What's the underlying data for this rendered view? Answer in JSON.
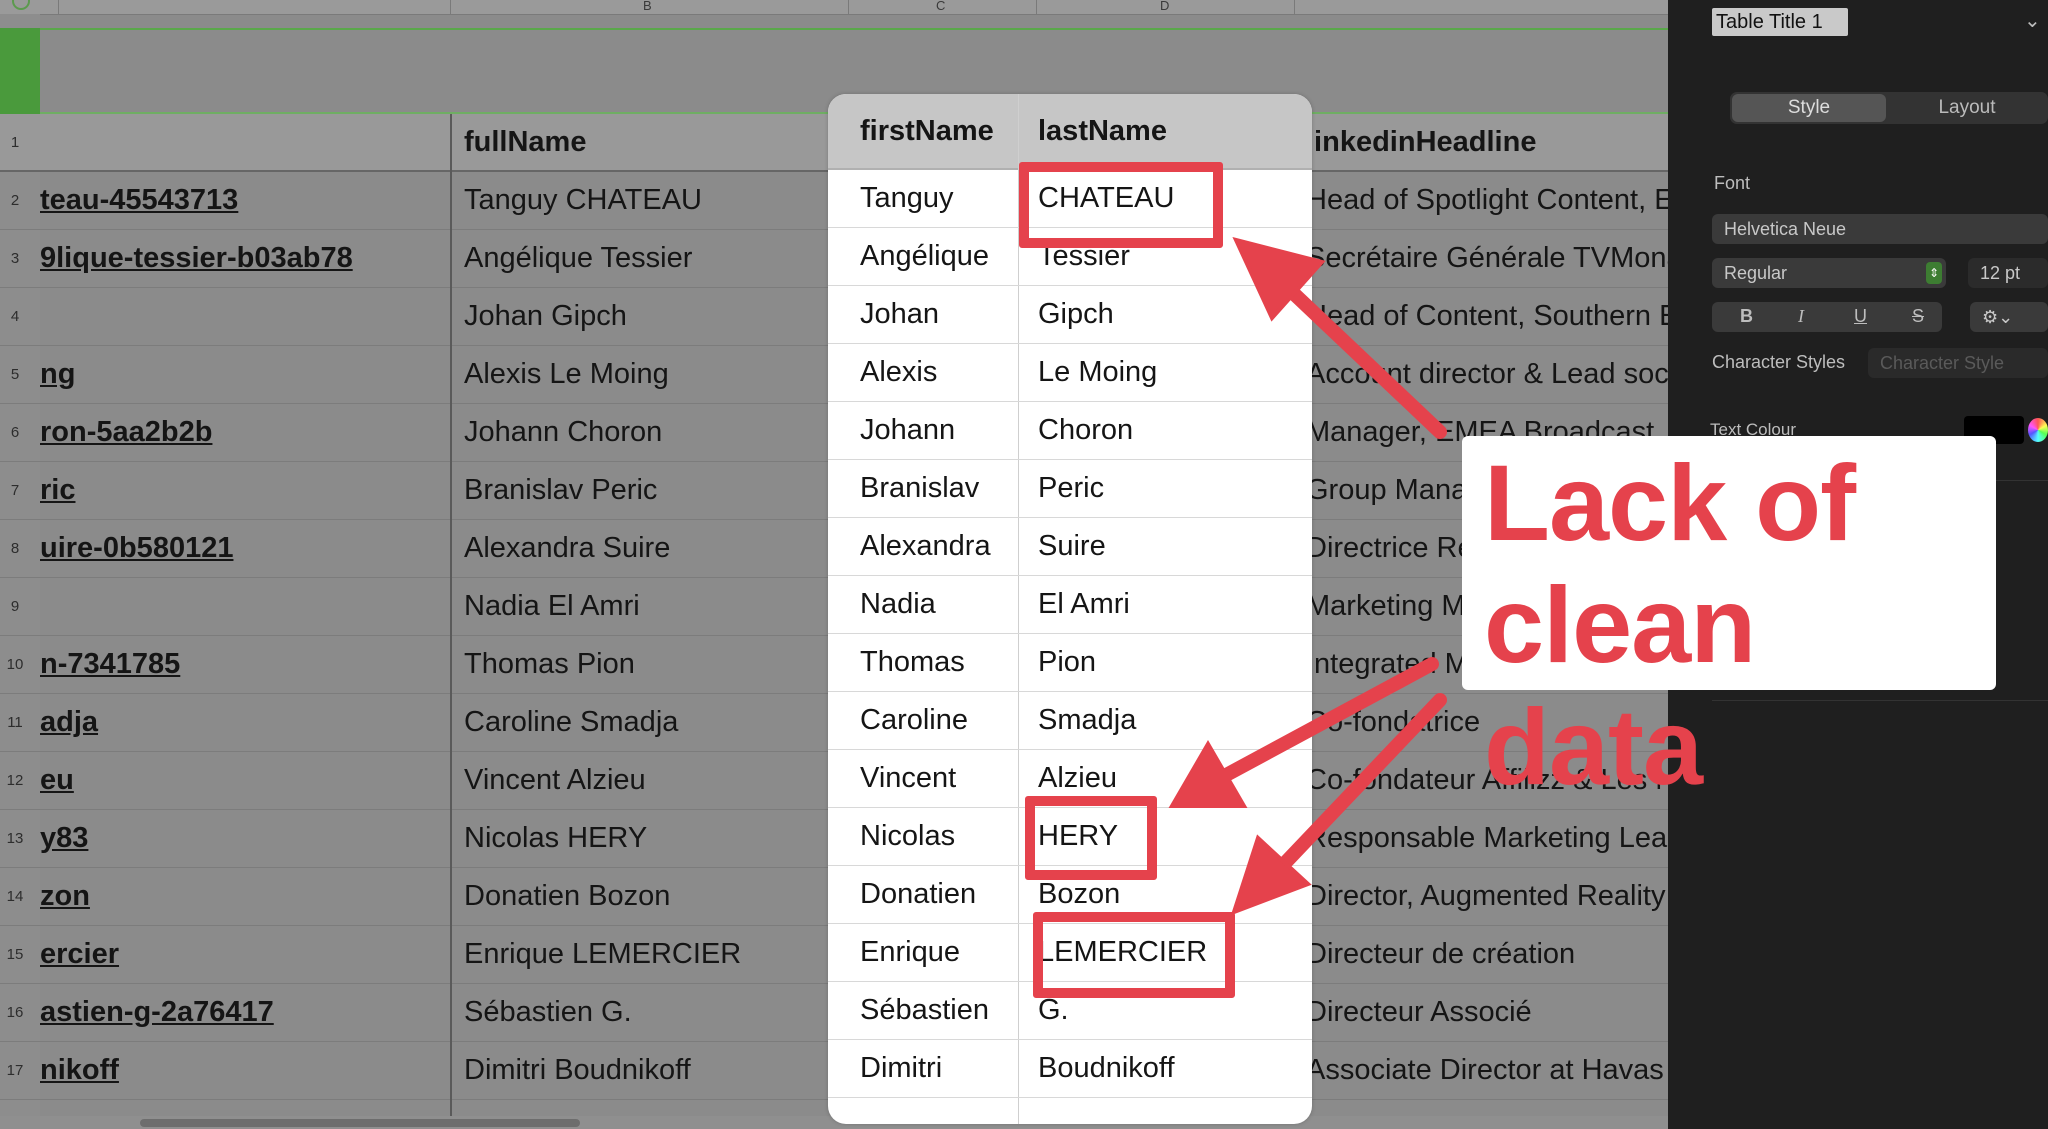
{
  "columns": {
    "b": "B",
    "c": "C",
    "d": "D"
  },
  "headers": {
    "url_partial": "",
    "full_name": "fullName",
    "first_name": "firstName",
    "last_name": "lastName",
    "headline": "linkedinHeadline"
  },
  "rows": [
    {
      "num": "1"
    },
    {
      "num": "2",
      "url": "teau-45543713",
      "full": "Tanguy CHATEAU",
      "first": "Tanguy",
      "last": "CHATEAU",
      "headline": "Head of Spotlight Content, E"
    },
    {
      "num": "3",
      "url": "9lique-tessier-b03ab78",
      "full": "Angélique Tessier",
      "first": "Angélique",
      "last": "Tessier",
      "headline": "Secrétaire Générale TVMona"
    },
    {
      "num": "4",
      "url": "",
      "full": "Johan Gipch",
      "first": "Johan",
      "last": "Gipch",
      "headline": "Head of Content, Southern E"
    },
    {
      "num": "5",
      "url": "ng",
      "full": "Alexis Le Moing",
      "first": "Alexis",
      "last": "Le Moing",
      "headline": "Account director & Lead soc"
    },
    {
      "num": "6",
      "url": "ron-5aa2b2b",
      "full": "Johann Choron",
      "first": "Johann",
      "last": "Choron",
      "headline": "Manager, EMEA Broadcast"
    },
    {
      "num": "7",
      "url": "ric",
      "full": "Branislav Peric",
      "first": "Branislav",
      "last": "Peric",
      "headline": "Group Mana"
    },
    {
      "num": "8",
      "url": "uire-0b580121",
      "full": "Alexandra Suire",
      "first": "Alexandra",
      "last": "Suire",
      "headline": "Directrice Re"
    },
    {
      "num": "9",
      "url": "",
      "full": "Nadia El Amri",
      "first": "Nadia",
      "last": "El Amri",
      "headline": "Marketing M"
    },
    {
      "num": "10",
      "url": "n-7341785",
      "full": "Thomas Pion",
      "first": "Thomas",
      "last": "Pion",
      "headline": "Integrated M"
    },
    {
      "num": "11",
      "url": "adja",
      "full": "Caroline Smadja",
      "first": "Caroline",
      "last": "Smadja",
      "headline": "Co-fondatrice"
    },
    {
      "num": "12",
      "url": "eu",
      "full": "Vincent Alzieu",
      "first": "Vincent",
      "last": "Alzieu",
      "headline": "Co-fondateur Affilizz & Les N"
    },
    {
      "num": "13",
      "url": "y83",
      "full": "Nicolas HERY",
      "first": "Nicolas",
      "last": "HERY",
      "headline": "Responsable Marketing Lea"
    },
    {
      "num": "14",
      "url": "zon",
      "full": "Donatien Bozon",
      "first": "Donatien",
      "last": "Bozon",
      "headline": "Director, Augmented Reality"
    },
    {
      "num": "15",
      "url": "ercier",
      "full": "Enrique LEMERCIER",
      "first": "Enrique",
      "last": "LEMERCIER",
      "headline": "Directeur de création"
    },
    {
      "num": "16",
      "url": "astien-g-2a76417",
      "full": "Sébastien G.",
      "first": "Sébastien",
      "last": "G.",
      "headline": "Directeur Associé"
    },
    {
      "num": "17",
      "url": "nikoff",
      "full": "Dimitri Boudnikoff",
      "first": "Dimitri",
      "last": "Boudnikoff",
      "headline": "Associate Director at Havas"
    }
  ],
  "sidebar": {
    "table_title": "Table Title 1",
    "tab_style": "Style",
    "tab_layout": "Layout",
    "font_label": "Font",
    "font_family": "Helvetica Neue",
    "font_style": "Regular",
    "font_size": "12 pt",
    "bold": "B",
    "italic": "I",
    "underline": "U",
    "strike": "S",
    "char_styles_label": "Character Styles",
    "char_style_value": "Character Style",
    "text_colour_label": "Text Colour"
  },
  "callout": {
    "line1": "Lack of",
    "line2": "clean data"
  },
  "colors": {
    "accent_red": "#e5424c",
    "green": "#4a9a3c"
  }
}
